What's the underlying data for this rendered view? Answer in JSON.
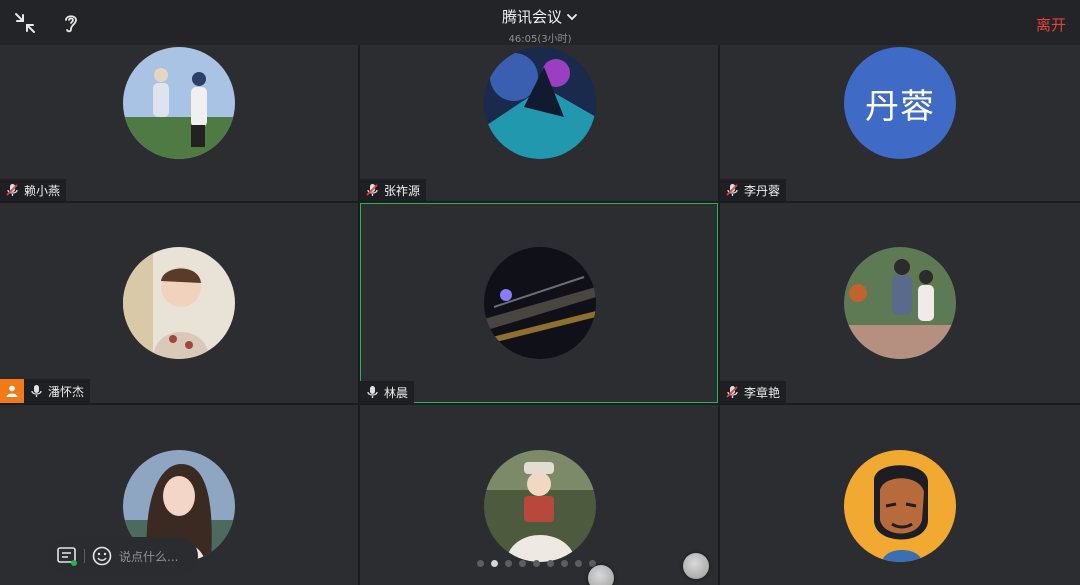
{
  "topbar": {
    "title": "腾讯会议",
    "subtitle": "46:05(3小时)",
    "leave_label": "离开",
    "icons": [
      "minimize-icon",
      "hearing-ear-icon",
      "chevron-down-icon"
    ]
  },
  "participants": [
    {
      "name": "赖小燕",
      "mic": "muted",
      "avatar": "photo-couple"
    },
    {
      "name": "张祚源",
      "mic": "muted",
      "avatar": "photo-game-art"
    },
    {
      "name": "李丹蓉",
      "mic": "muted",
      "avatar_text": "丹蓉",
      "avatar_color": "#3f6ac5"
    },
    {
      "name": "潘怀杰",
      "mic": "on",
      "host": true,
      "avatar": "photo-child"
    },
    {
      "name": "林晨",
      "mic": "on",
      "active_speaker": true,
      "avatar": "photo-night-lights"
    },
    {
      "name": "李章艳",
      "mic": "muted",
      "avatar": "photo-basketball-couple"
    },
    {
      "name": "",
      "avatar": "photo-woman-portrait"
    },
    {
      "name": "",
      "avatar": "photo-child-hat"
    },
    {
      "name": "",
      "avatar": "illustration-man-orange"
    }
  ],
  "chat": {
    "placeholder": "说点什么...",
    "icons": [
      "chat-bubble-icon",
      "emoji-icon"
    ]
  },
  "pager": {
    "total": 9,
    "current": 2
  },
  "colors": {
    "accent_green": "#1db84e",
    "leave_red": "#e5413e",
    "host_orange": "#f07a1a"
  }
}
